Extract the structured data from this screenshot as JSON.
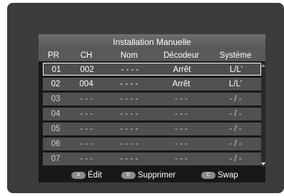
{
  "dialog": {
    "title": "Installation Manuelle"
  },
  "table": {
    "columns": [
      "PR",
      "CH",
      "Nom",
      "Décodeur",
      "Système"
    ],
    "rows": [
      {
        "pr": "01",
        "ch": "002",
        "nom": "- - - -",
        "decodeur": "Arrêt",
        "systeme": "L/L'"
      },
      {
        "pr": "02",
        "ch": "004",
        "nom": "- - - -",
        "decodeur": "Arrêt",
        "systeme": "L/L'"
      },
      {
        "pr": "03",
        "ch": "- - -",
        "nom": "- - - -",
        "decodeur": "- - -",
        "systeme": "- / -"
      },
      {
        "pr": "04",
        "ch": "- - -",
        "nom": "- - - -",
        "decodeur": "- - -",
        "systeme": "- / -"
      },
      {
        "pr": "05",
        "ch": "- - -",
        "nom": "- - - -",
        "decodeur": "- - -",
        "systeme": "- / -"
      },
      {
        "pr": "06",
        "ch": "- - -",
        "nom": "- - - -",
        "decodeur": "- - -",
        "systeme": "- / -"
      },
      {
        "pr": "07",
        "ch": "- - -",
        "nom": "- - - -",
        "decodeur": "- - -",
        "systeme": "- / -"
      }
    ],
    "selected_index": 0
  },
  "footer": {
    "buttons": [
      {
        "key": "A",
        "label": "Édit"
      },
      {
        "key": "B",
        "label": "Supprimer"
      },
      {
        "key": "C",
        "label": "Swap"
      }
    ]
  },
  "icons": {
    "scroll_up": "scroll-up-arrow-icon",
    "scroll_down": "scroll-down-arrow-icon"
  }
}
